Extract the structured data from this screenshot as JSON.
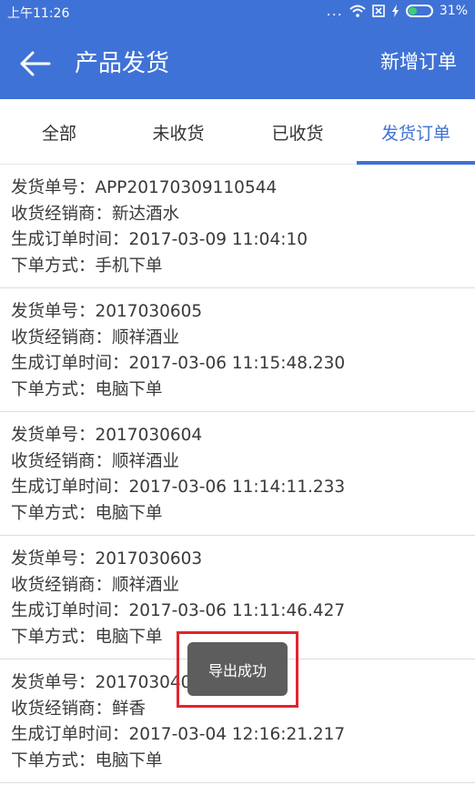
{
  "status": {
    "time": "上午11:26",
    "dots": "...",
    "battery": "31%"
  },
  "header": {
    "title": "产品发货",
    "add_order": "新增订单"
  },
  "tabs": [
    {
      "label": "全部"
    },
    {
      "label": "未收货"
    },
    {
      "label": "已收货"
    },
    {
      "label": "发货订单"
    }
  ],
  "orders": [
    {
      "order_no": "发货单号：APP20170309110544",
      "dealer": "收货经销商：新达酒水",
      "created": "生成订单时间：2017-03-09 11:04:10",
      "method": "下单方式：手机下单"
    },
    {
      "order_no": "发货单号：2017030605",
      "dealer": "收货经销商：顺祥酒业",
      "created": "生成订单时间：2017-03-06 11:15:48.230",
      "method": "下单方式：电脑下单"
    },
    {
      "order_no": "发货单号：2017030604",
      "dealer": "收货经销商：顺祥酒业",
      "created": "生成订单时间：2017-03-06 11:14:11.233",
      "method": "下单方式：电脑下单"
    },
    {
      "order_no": "发货单号：2017030603",
      "dealer": "收货经销商：顺祥酒业",
      "created": "生成订单时间：2017-03-06 11:11:46.427",
      "method": "下单方式：电脑下单"
    },
    {
      "order_no": "发货单号：2017030404",
      "dealer": "收货经销商：鲜香",
      "created": "生成订单时间：2017-03-04 12:16:21.217",
      "method": "下单方式：电脑下单"
    }
  ],
  "toast": {
    "text": "导出成功"
  },
  "colors": {
    "primary": "#3f72d6",
    "highlight": "#e3242b",
    "battery": "#39d16a"
  }
}
